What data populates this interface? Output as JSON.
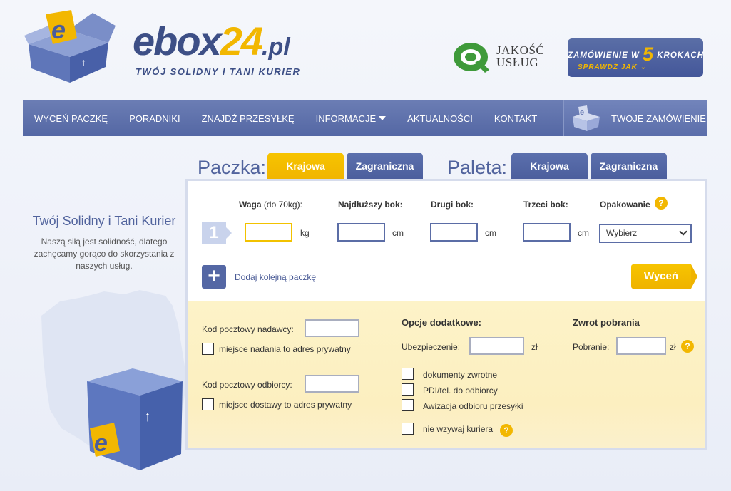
{
  "header": {
    "logo": {
      "part1": "ebox",
      "part2": "24",
      "part3": ".pl"
    },
    "tagline": "TWÓJ SOLIDNY I TANI KURIER",
    "quality_badge": {
      "line1": "JAKOŚĆ",
      "line2": "USŁUG"
    },
    "order_steps": {
      "prefix": "ZAMÓWIENIE W",
      "number": "5",
      "suffix": "KROKACH",
      "link": "SPRAWDŹ JAK"
    }
  },
  "nav": {
    "items": [
      {
        "label": "WYCEŃ PACZKĘ"
      },
      {
        "label": "PORADNIKI"
      },
      {
        "label": "ZNAJDŹ PRZESYŁKĘ"
      },
      {
        "label": "INFORMACJE"
      },
      {
        "label": "AKTUALNOŚCI"
      },
      {
        "label": "KONTAKT"
      }
    ],
    "order_label": "TWOJE ZAMÓWIENIE"
  },
  "tabs": {
    "parcel_label": "Paczka:",
    "pallet_label": "Paleta:",
    "parcel": [
      "Krajowa",
      "Zagraniczna"
    ],
    "pallet": [
      "Krajowa",
      "Zagraniczna"
    ]
  },
  "promo": {
    "title": "Twój Solidny i Tani Kurier",
    "text": "Naszą siłą jest solidność, dlatego zachęcamy gorąco do skorzystania z naszych usług."
  },
  "form": {
    "step": "1",
    "weight_label": "Waga",
    "weight_hint": "(do 70kg):",
    "longest_label": "Najdłuższy bok:",
    "second_label": "Drugi bok:",
    "third_label": "Trzeci bok:",
    "packaging_label": "Opakowanie",
    "unit_kg": "kg",
    "unit_cm": "cm",
    "packaging_selected": "Wybierz",
    "add_parcel": "Dodaj kolejną paczkę",
    "submit": "Wyceń",
    "help": "?",
    "weight_value": "",
    "longest_value": "",
    "second_value": "",
    "third_value": ""
  },
  "details": {
    "sender_zip_label": "Kod pocztowy nadawcy:",
    "sender_private": "miejsce nadania to adres prywatny",
    "receiver_zip_label": "Kod pocztowy odbiorcy:",
    "receiver_private": "miejsce dostawy to adres prywatny",
    "options_title": "Opcje dodatkowe:",
    "insurance_label": "Ubezpieczenie:",
    "currency": "zł",
    "options": [
      "dokumenty zwrotne",
      "PDI/tel. do odbiorcy",
      "Awizacja odbioru przesyłki",
      "nie wzywaj kuriera"
    ],
    "cod_title": "Zwrot pobrania",
    "cod_label": "Pobranie:"
  },
  "colors": {
    "brand_blue": "#4a5d9c",
    "brand_yellow": "#f2b701",
    "panel_yellow": "#fdf3c8"
  }
}
